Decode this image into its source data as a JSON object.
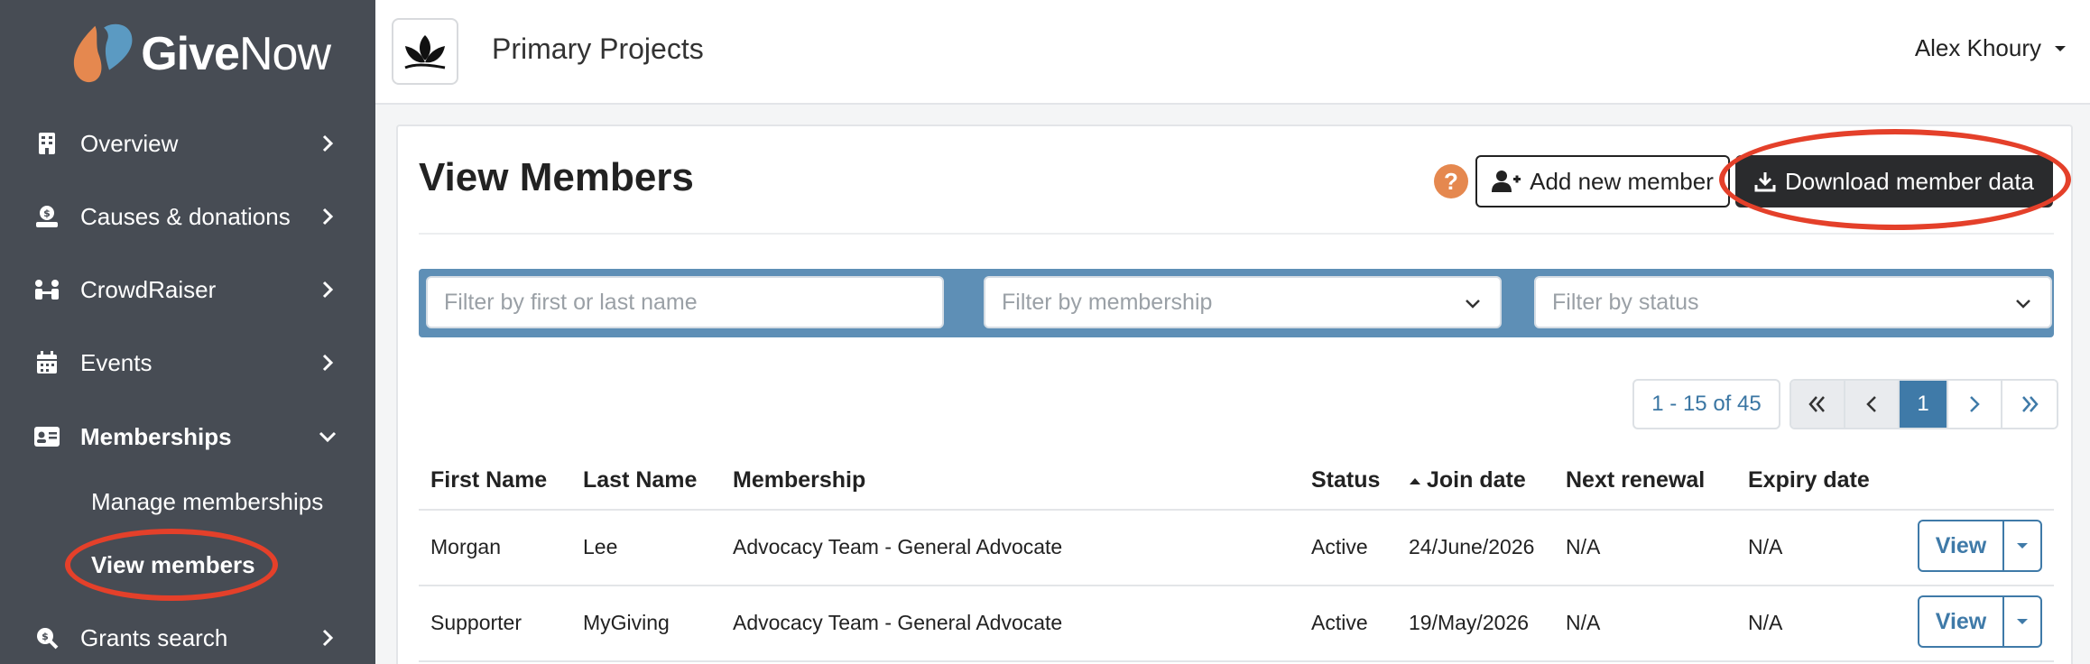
{
  "brand": {
    "name_bold": "Give",
    "name_light": "Now"
  },
  "org": {
    "name": "Primary Projects"
  },
  "user": {
    "name": "Alex Khoury"
  },
  "sidebar": {
    "items": [
      {
        "label": "Overview",
        "icon": "building-icon"
      },
      {
        "label": "Causes & donations",
        "icon": "donation-icon"
      },
      {
        "label": "CrowdRaiser",
        "icon": "people-icon"
      },
      {
        "label": "Events",
        "icon": "calendar-icon"
      },
      {
        "label": "Memberships",
        "icon": "id-card-icon"
      },
      {
        "label": "Grants search",
        "icon": "search-dollar-icon"
      }
    ],
    "subitems": [
      {
        "label": "Manage memberships"
      },
      {
        "label": "View members"
      }
    ]
  },
  "page": {
    "title": "View Members",
    "help": "?",
    "add_button": "Add new member",
    "download_button": "Download member data"
  },
  "filters": {
    "name_placeholder": "Filter by first or last name",
    "membership_placeholder": "Filter by membership",
    "status_placeholder": "Filter by status"
  },
  "pagination": {
    "info": "1 - 15 of 45",
    "current": "1"
  },
  "table": {
    "columns": [
      "First Name",
      "Last Name",
      "Membership",
      "Status",
      "Join date",
      "Next renewal",
      "Expiry date"
    ],
    "rows": [
      {
        "first": "Morgan",
        "last": "Lee",
        "membership": "Advocacy Team - General Advocate",
        "status": "Active",
        "join": "24/June/2026",
        "renewal": "N/A",
        "expiry": "N/A",
        "action": "View"
      },
      {
        "first": "Supporter",
        "last": "MyGiving",
        "membership": "Advocacy Team - General Advocate",
        "status": "Active",
        "join": "19/May/2026",
        "renewal": "N/A",
        "expiry": "N/A",
        "action": "View"
      }
    ]
  },
  "colors": {
    "sidebar": "#474c54",
    "accent": "#3f7aa8",
    "filterbar": "#5e8fb6",
    "highlight": "#e4402a",
    "help": "#e5884f"
  }
}
